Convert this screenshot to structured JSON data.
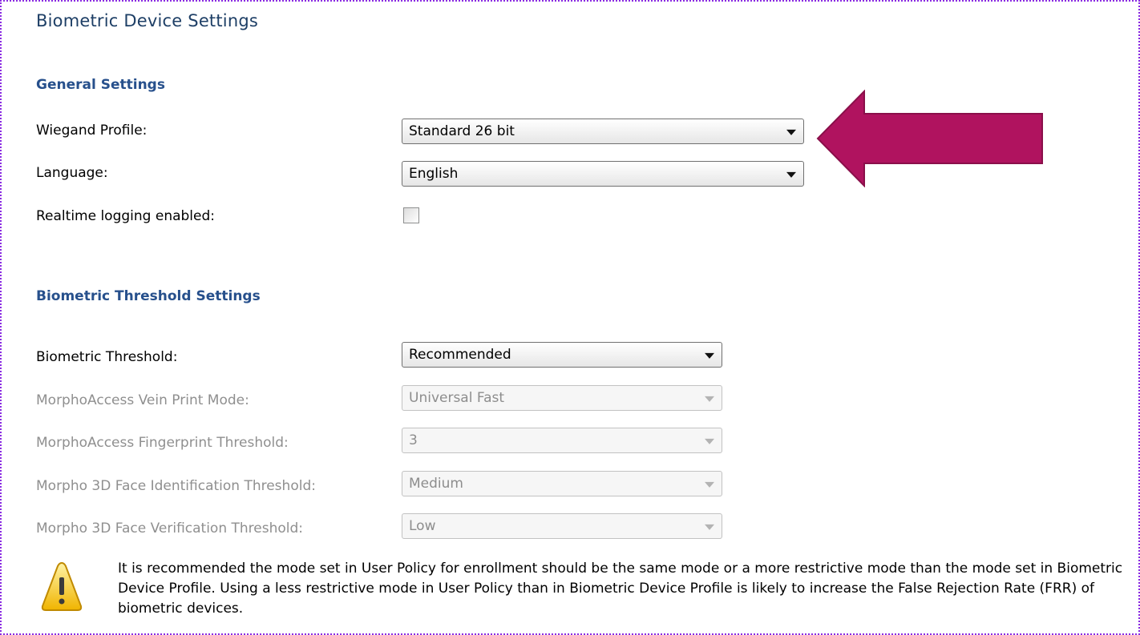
{
  "page": {
    "title": "Biometric Device Settings"
  },
  "general": {
    "title": "General Settings",
    "wiegand_label": "Wiegand Profile:",
    "wiegand_value": "Standard 26 bit",
    "language_label": "Language:",
    "language_value": "English",
    "realtime_label": "Realtime logging enabled:",
    "realtime_checked": false
  },
  "threshold": {
    "title": "Biometric Threshold Settings",
    "biometric_label": "Biometric Threshold:",
    "biometric_value": "Recommended",
    "vein_label": "MorphoAccess Vein Print Mode:",
    "vein_value": "Universal Fast",
    "fingerprint_label": "MorphoAccess Fingerprint Threshold:",
    "fingerprint_value": "3",
    "face_id_label": "Morpho 3D Face Identification Threshold:",
    "face_id_value": "Medium",
    "face_ver_label": "Morpho 3D Face Verification Threshold:",
    "face_ver_value": "Low"
  },
  "warning": {
    "icon": "warning-icon",
    "text": "It is recommended the mode set in User Policy for enrollment should be the same mode or a more restrictive mode than the mode set in Biometric Device Profile.  Using a less restrictive mode in User Policy than in Biometric Device Profile is likely to increase the False Rejection Rate (FRR) of biometric devices."
  },
  "colors": {
    "annotation_arrow": "#b0135f",
    "section_title": "#27508c",
    "page_title": "#1e3f66",
    "frame_border": "#8a2be2"
  }
}
